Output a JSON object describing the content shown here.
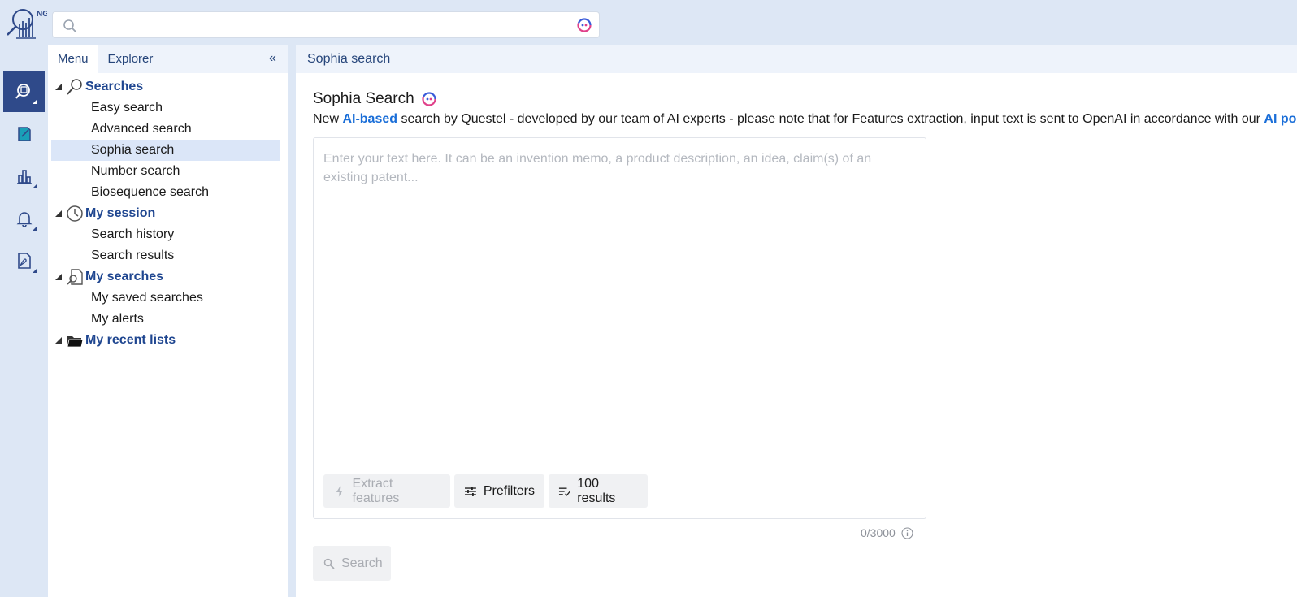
{
  "topbar": {
    "logo_text": "NG",
    "search_placeholder": ""
  },
  "rail": {
    "items": [
      {
        "name": "search-tool",
        "active": true
      },
      {
        "name": "edit-tool",
        "active": false
      },
      {
        "name": "analytics-tool",
        "active": false
      },
      {
        "name": "alerts-tool",
        "active": false
      },
      {
        "name": "documents-tool",
        "active": false
      }
    ]
  },
  "nav": {
    "tabs": [
      {
        "label": "Menu",
        "active": true
      },
      {
        "label": "Explorer",
        "active": false
      }
    ],
    "groups": [
      {
        "label": "Searches",
        "icon": "search-icon",
        "items": [
          {
            "label": "Easy search",
            "selected": false
          },
          {
            "label": "Advanced search",
            "selected": false
          },
          {
            "label": "Sophia search",
            "selected": true
          },
          {
            "label": "Number search",
            "selected": false
          },
          {
            "label": "Biosequence search",
            "selected": false
          }
        ]
      },
      {
        "label": "My session",
        "icon": "clock-icon",
        "items": [
          {
            "label": "Search history",
            "selected": false
          },
          {
            "label": "Search results",
            "selected": false
          }
        ]
      },
      {
        "label": "My searches",
        "icon": "saved-search-icon",
        "items": [
          {
            "label": "My saved searches",
            "selected": false
          },
          {
            "label": "My alerts",
            "selected": false
          }
        ]
      },
      {
        "label": "My recent lists",
        "icon": "folder-icon",
        "items": []
      }
    ]
  },
  "main": {
    "breadcrumb": "Sophia search",
    "title": "Sophia Search",
    "description": {
      "part1": "New ",
      "link1": "AI-based",
      "part2": " search by Questel - developed by our team of AI experts - please note that for Features extraction, input text is sent to OpenAI in accordance with our ",
      "link2": "AI policy"
    },
    "textarea_placeholder": "Enter your text here. It can be an invention memo, a product description, an idea, claim(s) of an existing patent...",
    "buttons": {
      "extract": "Extract features",
      "prefilters": "Prefilters",
      "results": "100 results"
    },
    "counter": "0/3000",
    "search_button": "Search"
  },
  "colors": {
    "accent": "#2f4a8a",
    "link": "#1a6ed8",
    "nav_heading": "#1f4690",
    "selected_bg": "#dbe6f8"
  }
}
